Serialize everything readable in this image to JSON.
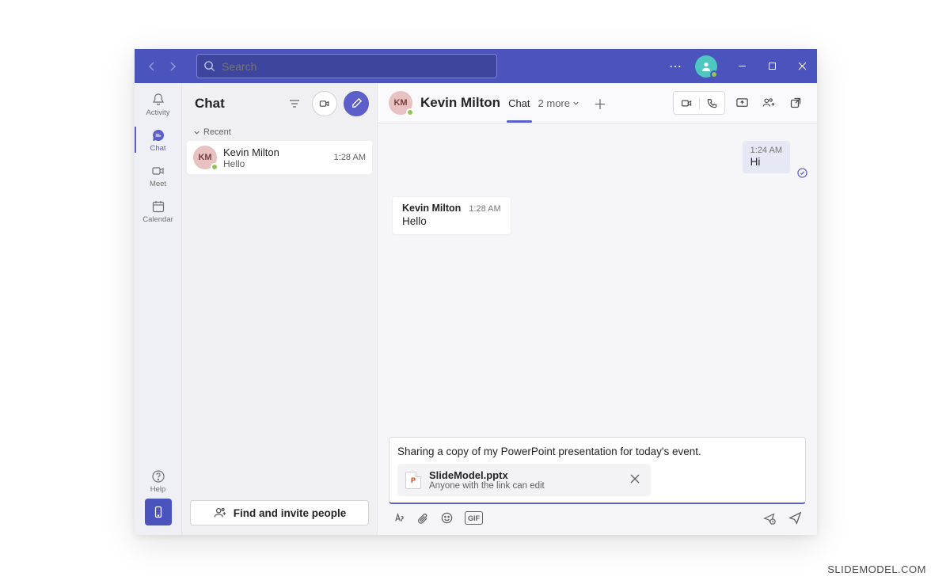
{
  "titlebar": {
    "search_placeholder": "Search"
  },
  "rail": {
    "activity": "Activity",
    "chat": "Chat",
    "meet": "Meet",
    "calendar": "Calendar",
    "help": "Help"
  },
  "list": {
    "title": "Chat",
    "recent_label": "Recent",
    "items": [
      {
        "initials": "KM",
        "name": "Kevin Milton",
        "preview": "Hello",
        "time": "1:28 AM"
      }
    ],
    "invite_label": "Find and invite people"
  },
  "convo": {
    "avatar_initials": "KM",
    "title": "Kevin Milton",
    "tab_chat": "Chat",
    "more_tabs": "2 more",
    "outgoing": {
      "time": "1:24 AM",
      "text": "Hi"
    },
    "incoming": {
      "name": "Kevin Milton",
      "time": "1:28 AM",
      "text": "Hello"
    }
  },
  "compose": {
    "text": "Sharing a copy of my PowerPoint presentation for today's event.",
    "attachment": {
      "filename": "SlideModel.pptx",
      "permission": "Anyone with the link can edit"
    },
    "gif_label": "GIF"
  },
  "watermark": "SLIDEMODEL.COM"
}
